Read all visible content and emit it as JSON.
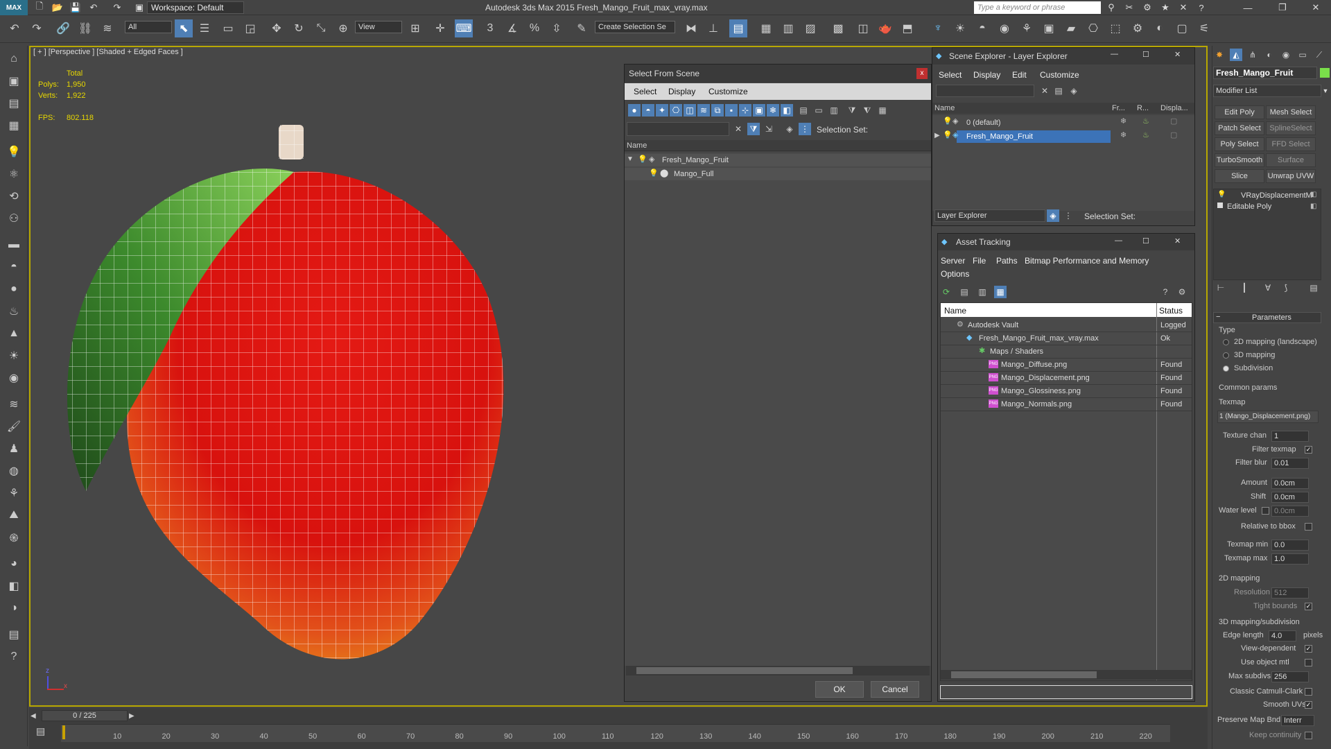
{
  "app": {
    "logo": "MAX",
    "title": "Autodesk 3ds Max  2015      Fresh_Mango_Fruit_max_vray.max",
    "workspace": "Workspace: Default",
    "search_placeholder": "Type a keyword or phrase"
  },
  "toolbar": {
    "selection_filter": "All",
    "ref_coord": "View",
    "named_selection": "Create Selection Se",
    "snap_3": "3",
    "snap_pct": "%"
  },
  "viewport": {
    "label": "[ + ] [Perspective ] [Shaded + Edged Faces ]",
    "stats": {
      "total_label": "Total",
      "polys_label": "Polys:",
      "polys_value": "1,950",
      "verts_label": "Verts:",
      "verts_value": "1,922",
      "fps_label": "FPS:",
      "fps_value": "802.118"
    },
    "axis_z": "z",
    "axis_x": "x"
  },
  "select_from_scene": {
    "title": "Select From Scene",
    "close": "x",
    "menu": [
      "Select",
      "Display",
      "Customize"
    ],
    "selection_set_label": "Selection Set:",
    "col_name": "Name",
    "tree": [
      {
        "label": "Fresh_Mango_Fruit"
      },
      {
        "label": "Mango_Full"
      }
    ],
    "ok": "OK",
    "cancel": "Cancel"
  },
  "scene_explorer": {
    "title": "Scene Explorer - Layer Explorer",
    "menu": [
      "Select",
      "Display",
      "Edit",
      "Customize"
    ],
    "columns": [
      "Name",
      "Fr...",
      "R...",
      "Displa..."
    ],
    "rows": [
      {
        "label": "0 (default)"
      },
      {
        "label": "Fresh_Mango_Fruit"
      }
    ],
    "footer_dropdown": "Layer Explorer",
    "selection_set_label": "Selection Set:"
  },
  "asset_tracking": {
    "title": "Asset Tracking",
    "menu": [
      "Server",
      "File",
      "Paths",
      "Bitmap Performance and Memory",
      "Options"
    ],
    "col_name": "Name",
    "col_status": "Status",
    "rows": [
      {
        "name": "Autodesk Vault",
        "status": "Logged"
      },
      {
        "name": "Fresh_Mango_Fruit_max_vray.max",
        "status": "Ok"
      },
      {
        "name": "Maps / Shaders",
        "status": ""
      },
      {
        "name": "Mango_Diffuse.png",
        "status": "Found"
      },
      {
        "name": "Mango_Displacement.png",
        "status": "Found"
      },
      {
        "name": "Mango_Glossiness.png",
        "status": "Found"
      },
      {
        "name": "Mango_Normals.png",
        "status": "Found"
      }
    ]
  },
  "command_panel": {
    "object_name": "Fresh_Mango_Fruit",
    "modifier_list": "Modifier List",
    "buttons": [
      [
        "Edit Poly",
        "Mesh Select"
      ],
      [
        "Patch Select",
        "SplineSelect"
      ],
      [
        "Poly Select",
        "FFD Select"
      ],
      [
        "TurboSmooth",
        "Surface Select"
      ],
      [
        "Slice",
        "Unwrap UVW"
      ]
    ],
    "stack": [
      "VRayDisplacementM",
      "Editable Poly"
    ],
    "parameters": {
      "title": "Parameters",
      "type_label": "Type",
      "type_options": [
        "2D mapping (landscape)",
        "3D mapping",
        "Subdivision"
      ],
      "common_params": "Common params",
      "texmap_label": "Texmap",
      "texmap_value": "1 (Mango_Displacement.png)",
      "texture_chan_label": "Texture chan",
      "texture_chan_value": "1",
      "filter_texmap_label": "Filter texmap",
      "filter_blur_label": "Filter blur",
      "filter_blur_value": "0.01",
      "amount_label": "Amount",
      "amount_value": "0.0cm",
      "shift_label": "Shift",
      "shift_value": "0.0cm",
      "water_level_label": "Water level",
      "water_level_value": "0.0cm",
      "relative_bbox_label": "Relative to bbox",
      "texmap_min_label": "Texmap min",
      "texmap_min_value": "0.0",
      "texmap_max_label": "Texmap max",
      "texmap_max_value": "1.0",
      "mapping2d": "2D mapping",
      "resolution_label": "Resolution",
      "resolution_value": "512",
      "tight_bounds_label": "Tight bounds",
      "mapping3d": "3D mapping/subdivision",
      "edge_length_label": "Edge length",
      "edge_length_value": "4.0",
      "pixels_label": "pixels",
      "view_dependent_label": "View-dependent",
      "use_object_mtl_label": "Use object mtl",
      "max_subdivs_label": "Max subdivs",
      "max_subdivs_value": "256",
      "classic_cc_label": "Classic Catmull-Clark",
      "smooth_uvs_label": "Smooth UVs",
      "preserve_map_label": "Preserve Map Bnd",
      "preserve_map_value": "Interr",
      "keep_continuity_label": "Keep continuity"
    }
  },
  "timeline": {
    "frame": "0 / 225",
    "ticks": [
      "10",
      "20",
      "30",
      "40",
      "50",
      "60",
      "70",
      "80",
      "90",
      "100",
      "110",
      "120",
      "130",
      "140",
      "150",
      "160",
      "170",
      "180",
      "190",
      "200",
      "210",
      "220"
    ]
  },
  "colors": {
    "viewport_border": "#b8a800",
    "selection": "#3c73b8",
    "stats_text": "#e8d800"
  }
}
